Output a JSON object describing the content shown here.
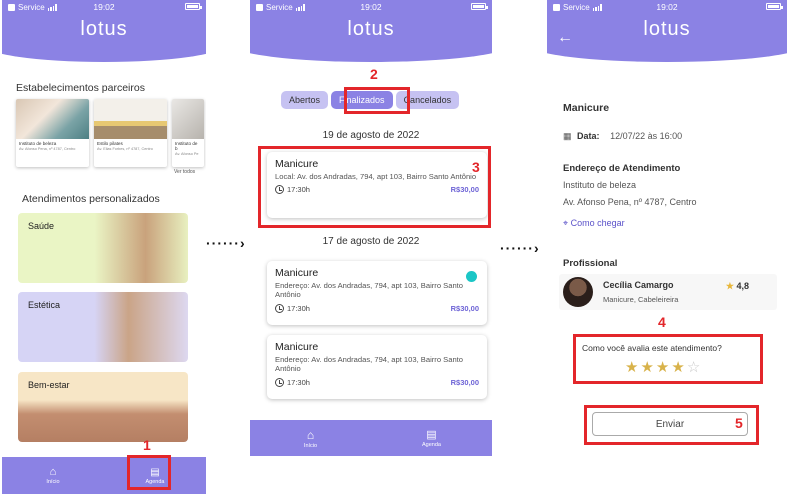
{
  "status": {
    "carrier": "Service",
    "time": "19:02"
  },
  "brand": {
    "logo": "lotus",
    "primary_color": "#8b82e4",
    "accent_color": "#e3262a"
  },
  "screen1": {
    "partners_title": "Estabelecimentos parceiros",
    "partners": [
      {
        "name": "Instituto de beleza",
        "address": "Av. Afonso Pena, nº 4787, Centro"
      },
      {
        "name": "Estilo pilates",
        "address": "Av. Elias Forbes, nº 4787, Centro"
      },
      {
        "name": "Instituto de b",
        "address": "Av. Afonso Pe"
      }
    ],
    "see_all": "Ver todos",
    "services_title": "Atendimentos personalizados",
    "services": [
      "Saúde",
      "Estética",
      "Bem-estar"
    ],
    "tabs": {
      "home": "Início",
      "schedule": "Agenda"
    },
    "annotation": "1"
  },
  "screen2": {
    "segments": [
      "Abertos",
      "Finalizados",
      "Cancelados"
    ],
    "annotation_tab": "2",
    "annotation_card": "3",
    "groups": [
      {
        "date": "19 de agosto de 2022",
        "items": [
          {
            "title": "Manicure",
            "address": "Local: Av. dos Andradas, 794, apt 103, Bairro Santo Antônio",
            "time": "17:30h",
            "price": "R$30,00"
          }
        ]
      },
      {
        "date": "17 de agosto de 2022",
        "items": [
          {
            "title": "Manicure",
            "address": "Endereço: Av. dos Andradas, 794, apt 103, Bairro Santo Antônio",
            "time": "17:30h",
            "price": "R$30,00"
          },
          {
            "title": "Manicure",
            "address": "Endereço: Av. dos Andradas, 794, apt 103, Bairro Santo Antônio",
            "time": "17:30h",
            "price": "R$30,00"
          }
        ]
      }
    ],
    "tabs": {
      "home": "Início",
      "schedule": "Agenda"
    }
  },
  "screen3": {
    "service": "Manicure",
    "date_label": "Data:",
    "date_value": "12/07/22 às 16:00",
    "address_title": "Endereço de Atendimento",
    "address_place": "Instituto de beleza",
    "address_street": "Av. Afonso Pena, nº 4787, Centro",
    "directions": "Como chegar",
    "professional_title": "Profissional",
    "professional_name": "Cecília Camargo",
    "professional_role": "Manicure, Cabeleireira",
    "professional_rating": "4,8",
    "annotation_rating": "4",
    "rating_question": "Como você avalia este atendimento?",
    "rating_value": 4,
    "rating_max": 5,
    "submit": "Enviar",
    "annotation_submit": "5"
  }
}
